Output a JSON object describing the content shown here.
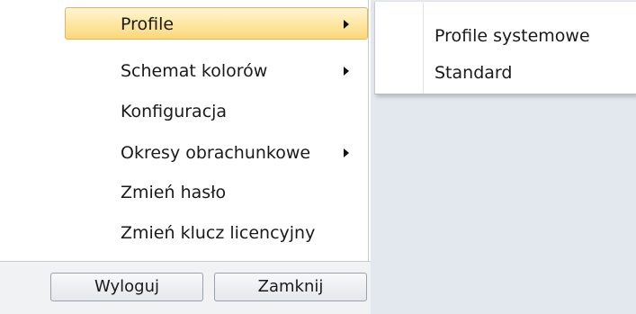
{
  "menu": {
    "items": [
      {
        "label": "Profile",
        "has_submenu": true,
        "active": true
      },
      {
        "label": "Schemat kolorów",
        "has_submenu": true
      },
      {
        "label": "Konfiguracja",
        "has_submenu": false
      },
      {
        "label": "Okresy obrachunkowe",
        "has_submenu": true
      },
      {
        "label": "Zmień hasło",
        "has_submenu": false
      },
      {
        "label": "Zmień klucz licencyjny",
        "has_submenu": false
      }
    ]
  },
  "submenu": {
    "items": [
      {
        "label": "Profile systemowe"
      },
      {
        "label": "Standard"
      }
    ]
  },
  "footer": {
    "logout_label": "Wyloguj",
    "close_label": "Zamknij"
  },
  "colors": {
    "highlight_top": "#fff6d6",
    "highlight_bottom": "#fbd77a",
    "highlight_border": "#e0b85a",
    "background_panel": "#e3e7ee"
  }
}
